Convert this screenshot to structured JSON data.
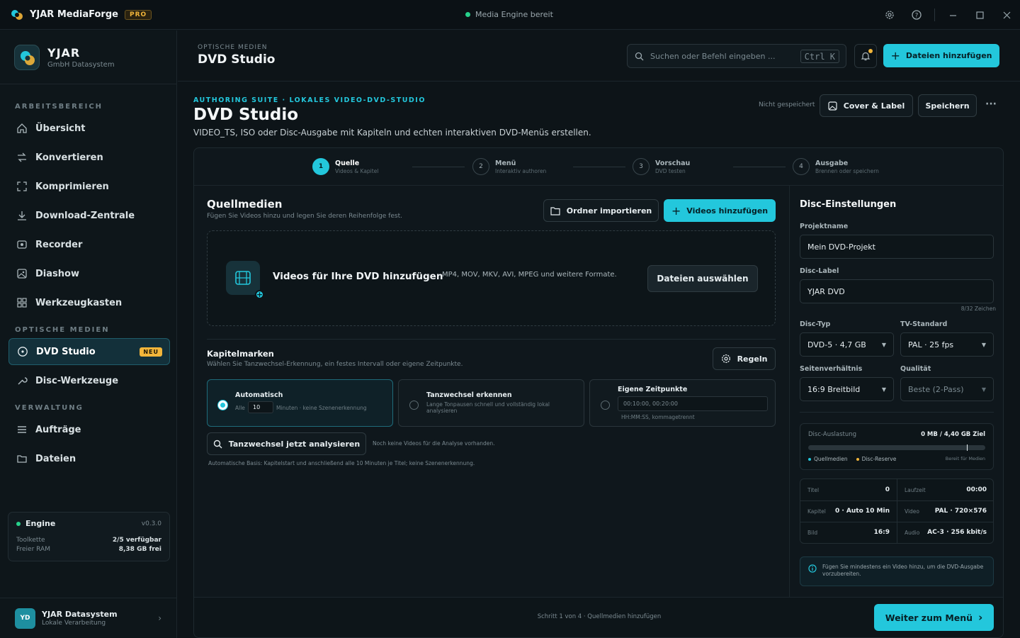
{
  "app": {
    "title": "YJAR MediaForge",
    "badge": "PRO",
    "status": "Media Engine bereit"
  },
  "brand": {
    "name": "YJAR",
    "sub": "GmbH Datasystem"
  },
  "nav": {
    "section_workspace": "ARBEITSBEREICH",
    "section_optical": "OPTISCHE MEDIEN",
    "section_admin": "VERWALTUNG",
    "items": [
      "Übersicht",
      "Konvertieren",
      "Komprimieren",
      "Download-Zentrale",
      "Recorder",
      "Diashow",
      "Werkzeugkasten"
    ],
    "dvd_studio": "DVD Studio",
    "dvd_badge": "NEU",
    "disc_tools": "Disc-Werkzeuge",
    "orders": "Aufträge",
    "files": "Dateien"
  },
  "engine": {
    "label": "Engine",
    "version": "v0.3.0",
    "toolchain_label": "Toolkette",
    "toolchain_value": "2/5 verfügbar",
    "ram_label": "Freier RAM",
    "ram_value": "8,38 GB frei"
  },
  "user": {
    "initials": "YD",
    "name": "YJAR Datasystem",
    "sub": "Lokale Verarbeitung"
  },
  "header": {
    "crumb": "OPTISCHE MEDIEN",
    "title": "DVD Studio",
    "search_placeholder": "Suchen oder Befehl eingeben ...",
    "search_kbd": "Ctrl K",
    "add_files": "Dateien hinzufügen"
  },
  "page": {
    "eyebrow": "AUTHORING SUITE · LOKALES VIDEO-DVD-STUDIO",
    "title": "DVD Studio",
    "desc": "VIDEO_TS, ISO oder Disc-Ausgabe mit Kapiteln und echten interaktiven DVD-Menüs erstellen.",
    "unsaved": "Nicht gespeichert",
    "cover_label": "Cover & Label",
    "save": "Speichern",
    "more": "···"
  },
  "steps": [
    {
      "num": "1",
      "title": "Quelle",
      "sub": "Videos & Kapitel"
    },
    {
      "num": "2",
      "title": "Menü",
      "sub": "Interaktiv authoren"
    },
    {
      "num": "3",
      "title": "Vorschau",
      "sub": "DVD testen"
    },
    {
      "num": "4",
      "title": "Ausgabe",
      "sub": "Brennen oder speichern"
    }
  ],
  "source": {
    "title": "Quellmedien",
    "desc": "Fügen Sie Videos hinzu und legen Sie deren Reihenfolge fest.",
    "import_folder": "Ordner importieren",
    "add_videos": "Videos hinzufügen",
    "drop_title": "Videos für Ihre DVD hinzufügen",
    "drop_formats": "MP4, MOV, MKV, AVI, MPEG und weitere Formate.",
    "choose_files": "Dateien auswählen"
  },
  "chapters": {
    "title": "Kapitelmarken",
    "desc": "Wählen Sie Tanzwechsel-Erkennung, ein festes Intervall oder eigene Zeitpunkte.",
    "rules": "Regeln",
    "auto_title": "Automatisch",
    "auto_prefix": "Alle",
    "auto_value": "10",
    "auto_suffix": "Minuten · keine Szenenerkennung",
    "dance_title": "Tanzwechsel erkennen",
    "dance_desc": "Lange Tonpausen schnell und vollständig lokal analysieren",
    "custom_title": "Eigene Zeitpunkte",
    "custom_value": "00:10:00, 00:20:00",
    "custom_hint": "HH:MM:SS, kommagetrennt",
    "analyze": "Tanzwechsel jetzt analysieren",
    "analyze_note": "Noch keine Videos für die Analyse vorhanden.",
    "basis": "Automatische Basis: Kapitelstart und anschließend alle 10 Minuten je Titel; keine Szenenerkennung."
  },
  "disc": {
    "title": "Disc-Einstellungen",
    "project_label": "Projektname",
    "project_value": "Mein DVD-Projekt",
    "disc_label": "Disc-Label",
    "disc_value": "YJAR DVD",
    "disc_count": "8/32 Zeichen",
    "type_label": "Disc-Typ",
    "type_value": "DVD-5 · 4,7 GB",
    "tv_label": "TV-Standard",
    "tv_value": "PAL · 25 fps",
    "aspect_label": "Seitenverhältnis",
    "aspect_value": "16:9 Breitbild",
    "quality_label": "Qualität",
    "quality_value": "Beste (2-Pass)",
    "usage_label": "Disc-Auslastung",
    "usage_value": "0 MB / 4,40 GB Ziel",
    "usage_fraction": 0,
    "legend_source": "Quellmedien",
    "legend_reserve": "Disc-Reserve",
    "legend_ready": "Bereit für Medien",
    "stats": [
      {
        "k": "Titel",
        "v": "0"
      },
      {
        "k": "Laufzeit",
        "v": "00:00"
      },
      {
        "k": "Kapitel",
        "v": "0 · Auto 10 Min"
      },
      {
        "k": "Video",
        "v": "PAL · 720×576"
      },
      {
        "k": "Bild",
        "v": "16:9"
      },
      {
        "k": "Audio",
        "v": "AC-3 · 256 kbit/s"
      }
    ],
    "info": "Fügen Sie mindestens ein Video hinzu, um die DVD-Ausgabe vorzubereiten."
  },
  "footer": {
    "step_text": "Schritt 1 von 4 · Quellmedien hinzufügen",
    "next": "Weiter zum Menü"
  },
  "colors": {
    "accent": "#23c7dc",
    "warning": "#f2b53a",
    "success": "#27d18b"
  }
}
